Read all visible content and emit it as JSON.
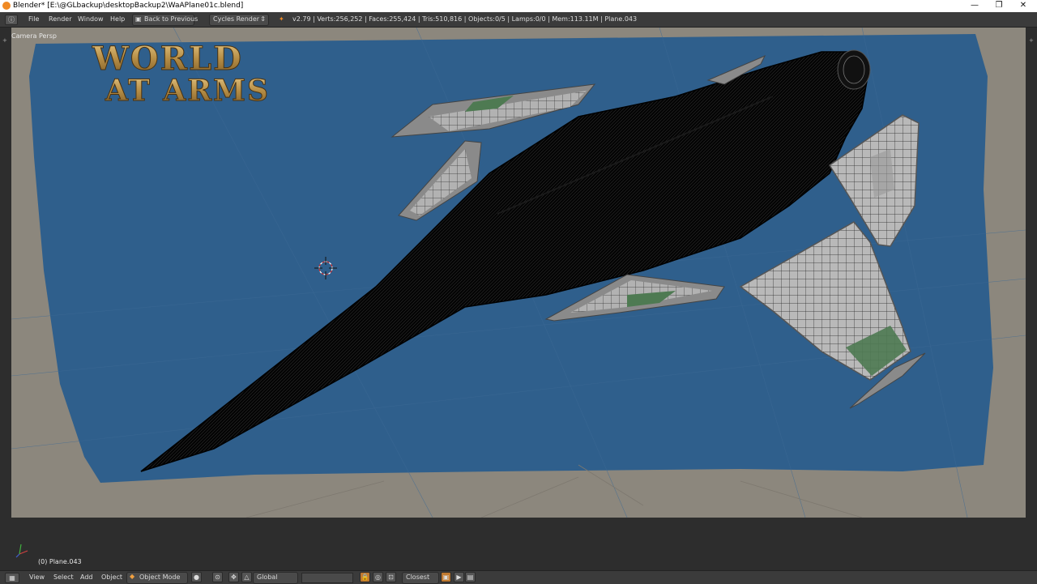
{
  "window": {
    "title": "Blender* [E:\\@GLbackup\\desktopBackup2\\WaAPlane01c.blend]",
    "minimize_glyph": "—",
    "restore_glyph": "❐",
    "close_glyph": "✕"
  },
  "info_header": {
    "menu": [
      "File",
      "Render",
      "Window",
      "Help"
    ],
    "back_button": "Back to Previous",
    "render_engine": "Cycles Render",
    "stats": "v2.79 | Verts:256,252 | Faces:255,424 | Tris:510,816 | Objects:0/5 | Lamps:0/0 | Mem:113.11M | Plane.043"
  },
  "viewport": {
    "view_label": "Camera Persp",
    "logo_line1": "WORLD",
    "logo_line2": "AT ARMS",
    "active_object": "(0) Plane.043"
  },
  "bottom_header": {
    "menu": [
      "View",
      "Select",
      "Add",
      "Object"
    ],
    "mode": "Object Mode",
    "orientation": "Global",
    "snap_element": "Closest"
  },
  "colors": {
    "sky": "#2f5f8c",
    "backdrop": "#8c877d",
    "ui_dark": "#2d2d2d",
    "header": "#3b3b3b",
    "logo_gold": "#c9a35a"
  }
}
